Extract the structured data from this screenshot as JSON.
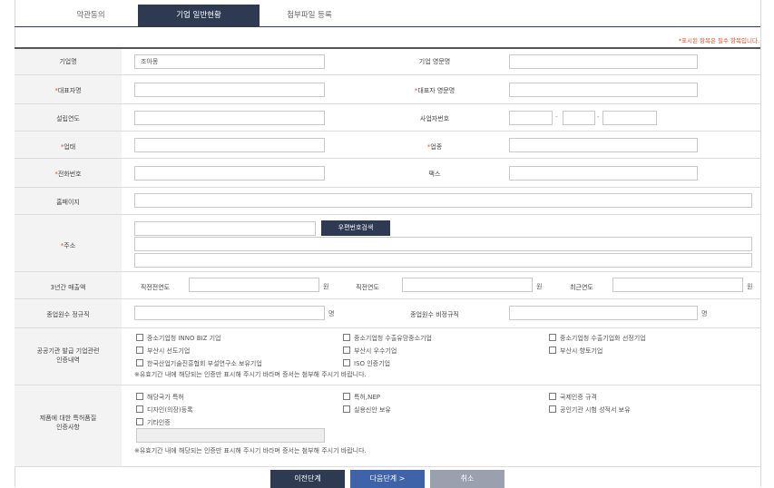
{
  "tabs": [
    "약관동의",
    "기업 일반현황",
    "첨부파일 등록"
  ],
  "notice": "*표시된 항목은 필수 항목입니다.",
  "fields": {
    "company_name_label": "기업명",
    "company_name_value": "조아몽",
    "company_name_en_label": "기업 영문명",
    "ceo_label": "대표자명",
    "ceo_en_label": "대표자 영문명",
    "founded_label": "설립연도",
    "biz_no_label": "사업자번호",
    "business_type_label": "업태",
    "industry_label": "업종",
    "phone_label": "전화번호",
    "fax_label": "팩스",
    "homepage_label": "홈페이지",
    "address_label": "주소",
    "postcode_button": "우편번호검색",
    "sales_label": "3년간 매출액",
    "sales_prev2": "직전전연도",
    "sales_prev1": "직전연도",
    "sales_recent": "최근연도",
    "won": "원",
    "regular_staff_label": "종업원수 정규직",
    "nonregular_staff_label": "종업원수 비정규직",
    "person_unit": "명"
  },
  "certs": {
    "label_line1": "공공기관 발급 기업관련",
    "label_line2": "인증내역",
    "items": [
      "중소기업청 INNO BIZ 기업",
      "중소기업청 수출유망중소기업",
      "중소기업청 수출기업화 선정기업",
      "부산시 선도기업",
      "부산시 우수기업",
      "부산시 향토기업",
      "한국산업기술진흥협회 부설연구소 보유기업",
      "ISO 인증기업"
    ],
    "note": "※유효기간 내에 해당되는 인증만 표시해 주시기 바라며 증서는 첨부해 주시기 바랍니다."
  },
  "patents": {
    "label_line1": "제품에 대한 특허품질",
    "label_line2": "인증사항",
    "items": [
      "해당국가 특허",
      "특허,NEP",
      "국제인증 규격",
      "디자인(의장)등록",
      "실용신안 보유",
      "공인기관 시험 성적서 보유",
      "기타인증"
    ],
    "note": "※유효기간 내에 해당되는 인증만 표시해 주시기 바라며 증서는 첨부해 주시기 바랍니다."
  },
  "buttons": {
    "prev": "이전단계",
    "next": "다음단계 >",
    "cancel": "취소"
  },
  "colors": {
    "navy": "#2e3a52",
    "required": "#e24f2a",
    "next": "#3f63a8",
    "cancel": "#9aa0ad"
  }
}
